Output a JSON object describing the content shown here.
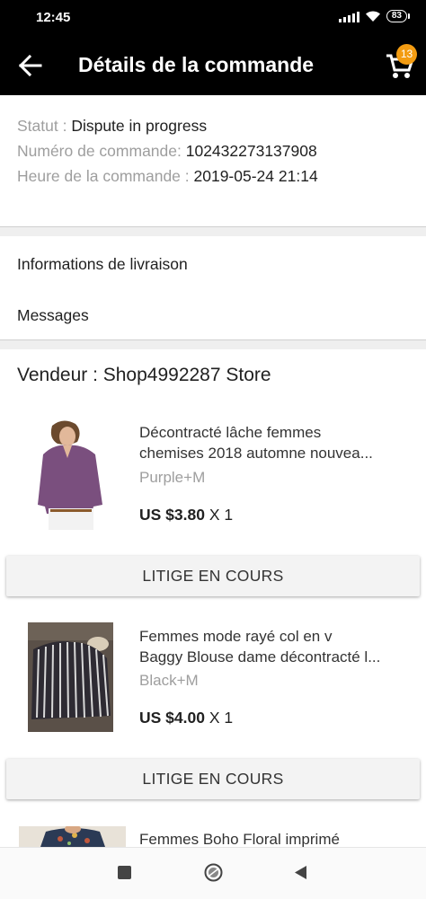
{
  "status_bar": {
    "time": "12:45",
    "battery": "83"
  },
  "app_bar": {
    "title": "Détails de la commande",
    "cart_count": "13"
  },
  "order": {
    "status_label": "Statut : ",
    "status_value": "Dispute in progress",
    "number_label": "Numéro de commande: ",
    "number_value": "102432273137908",
    "time_label": "Heure de la commande : ",
    "time_value": "2019-05-24 21:14"
  },
  "menu": {
    "delivery": "Informations de livraison",
    "messages": "Messages"
  },
  "vendor": "Vendeur : Shop4992287 Store",
  "products": [
    {
      "title_line1": "Décontracté lâche femmes",
      "title_line2": "chemises 2018 automne nouvea...",
      "variant": "Purple+M",
      "price": "US $3.80",
      "qty": " X 1",
      "action": "LITIGE EN COURS"
    },
    {
      "title_line1": "Femmes mode rayé col en v",
      "title_line2": "Baggy Blouse dame décontracté l...",
      "variant": "Black+M",
      "price": "US $4.00",
      "qty": " X 1",
      "action": "LITIGE EN COURS"
    },
    {
      "title_line1": "Femmes Boho Floral imprimé"
    }
  ],
  "colors": {
    "appbar": "#000000",
    "badge": "#f39c12",
    "muted_text": "#9e9e9e"
  },
  "icons": [
    "back-arrow-icon",
    "cart-icon",
    "wifi-icon",
    "signal-icon",
    "battery-icon",
    "nav-recent-icon",
    "nav-home-icon",
    "nav-back-icon"
  ]
}
